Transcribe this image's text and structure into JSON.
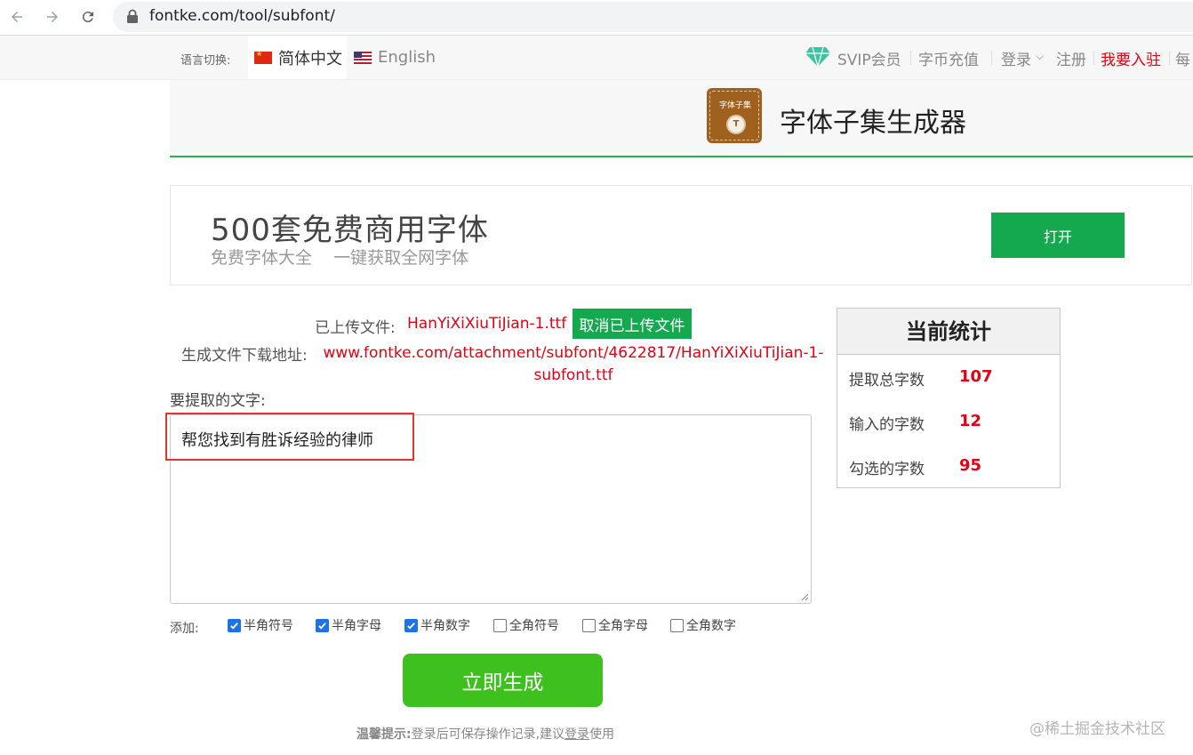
{
  "browser": {
    "url": "fontke.com/tool/subfont/"
  },
  "topbar": {
    "lang_label": "语言切换:",
    "lang_zh": "简体中文",
    "lang_en": "English",
    "svip": "SVIP会员",
    "recharge": "字币充值",
    "login": "登录",
    "register": "注册",
    "join": "我要入驻",
    "more": "每"
  },
  "header": {
    "logo_text": "字体子集",
    "logo_coin": "T",
    "title": "字体子集生成器"
  },
  "ad": {
    "title": "500套免费商用字体",
    "subtitle": "免费字体大全    一键获取全网字体",
    "button": "打开"
  },
  "upload": {
    "uploaded_label": "已上传文件:",
    "uploaded_file": "HanYiXiXiuTiJian-1.ttf",
    "cancel_button": "取消已上传文件",
    "download_label": "生成文件下载地址:",
    "download_url": "www.fontke.com/attachment/subfont/4622817/HanYiXiXiuTiJian-1-subfont.ttf"
  },
  "extract": {
    "label": "要提取的文字:",
    "value": "帮您找到有胜诉经验的律师"
  },
  "options": {
    "add_label": "添加:",
    "items": [
      {
        "label": "半角符号",
        "checked": true
      },
      {
        "label": "半角字母",
        "checked": true
      },
      {
        "label": "半角数字",
        "checked": true
      },
      {
        "label": "全角符号",
        "checked": false
      },
      {
        "label": "全角字母",
        "checked": false
      },
      {
        "label": "全角数字",
        "checked": false
      }
    ]
  },
  "generate_button": "立即生成",
  "tip": {
    "prefix": "温馨提示:",
    "text": "登录后可保存操作记录,建议",
    "link": "登录",
    "suffix": "使用"
  },
  "stats": {
    "title": "当前统计",
    "rows": [
      {
        "label": "提取总字数",
        "value": "107"
      },
      {
        "label": "输入的字数",
        "value": "12"
      },
      {
        "label": "勾选的字数",
        "value": "95"
      }
    ]
  },
  "watermark": "@稀土掘金技术社区",
  "colors": {
    "accent_green": "#14a84f",
    "generate_green": "#3ec01e",
    "alert_red": "#e60012",
    "highlight_red": "#e0362c"
  }
}
